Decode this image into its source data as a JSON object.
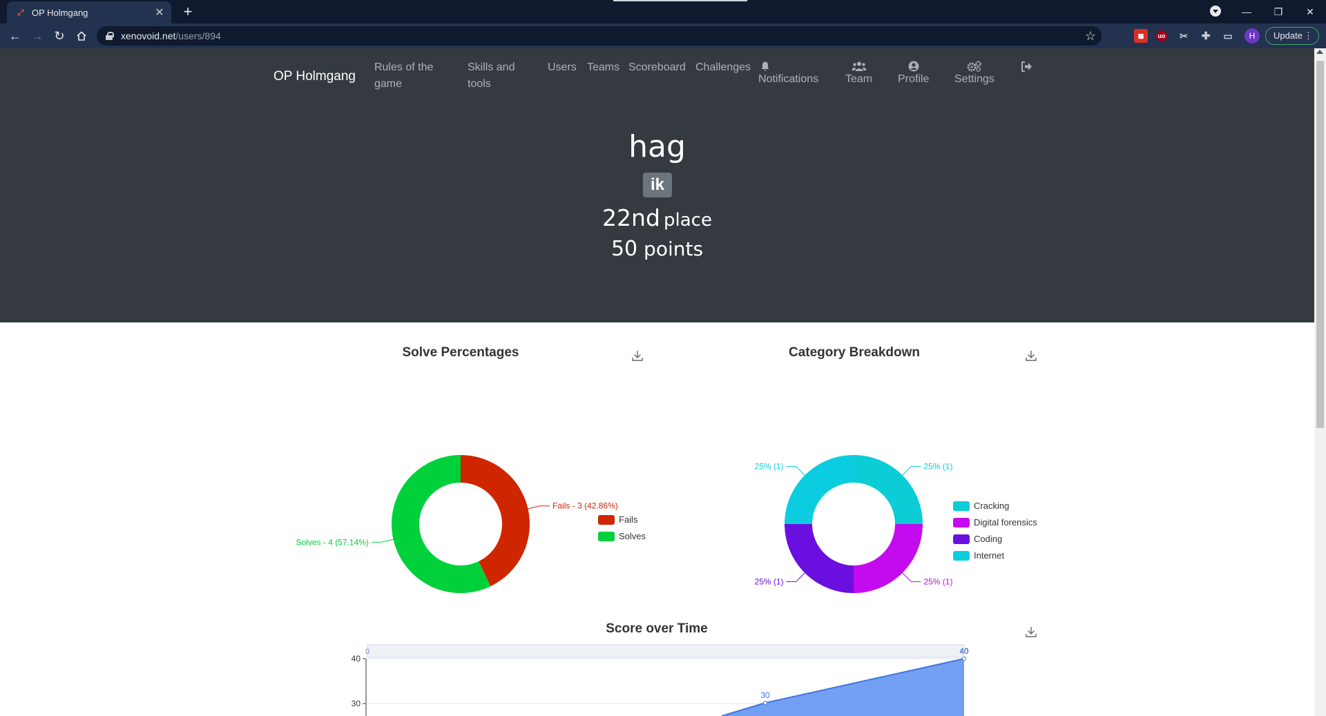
{
  "browser": {
    "tab_title": "OP Holmgang",
    "new_tab_symbol": "+",
    "url_host": "xenovoid.net",
    "url_path": "/users/894",
    "update_label": "Update",
    "profile_initial": "H"
  },
  "nav": {
    "brand": "OP Holmgang",
    "links": {
      "rules": "Rules of the game",
      "skills": "Skills and tools",
      "users": "Users",
      "teams": "Teams",
      "scoreboard": "Scoreboard",
      "challenges": "Challenges",
      "notifications": "Notifications",
      "team": "Team",
      "profile": "Profile",
      "settings": "Settings"
    }
  },
  "user": {
    "name": "hag",
    "team_badge": "ik",
    "place_number": "22nd",
    "place_word": "place",
    "points_number": "50",
    "points_word": "points"
  },
  "chart_data": [
    {
      "type": "pie",
      "title": "Solve Percentages",
      "labels": [
        "Fails",
        "Solves"
      ],
      "values": [
        3,
        4
      ],
      "colors": [
        "#cf2600",
        "#00d03a"
      ],
      "data_labels": [
        "Fails - 3 (42.86%)",
        "Solves - 4 (57.14%)"
      ],
      "legend_placement": "right"
    },
    {
      "type": "pie",
      "title": "Category Breakdown",
      "labels": [
        "Cracking",
        "Digital forensics",
        "Coding",
        "Internet"
      ],
      "values": [
        1,
        1,
        1,
        1
      ],
      "colors": [
        "#0ccdd6",
        "#c40aef",
        "#6a0fe0",
        "#0ccde0"
      ],
      "data_labels": [
        "25% (1)",
        "25% (1)",
        "25% (1)",
        "25% (1)"
      ],
      "legend_placement": "right"
    },
    {
      "type": "area",
      "title": "Score over Time",
      "y_ticks": [
        30,
        40
      ],
      "points": [
        {
          "label": "30",
          "y": 30
        },
        {
          "label": "40",
          "y": 40
        }
      ],
      "slider_start_label": "0",
      "slider_end_label": "40",
      "color": "#5b8ff0"
    }
  ],
  "colors": {
    "hero_bg": "#343a40",
    "browser_frame": "#0f1a2f"
  }
}
